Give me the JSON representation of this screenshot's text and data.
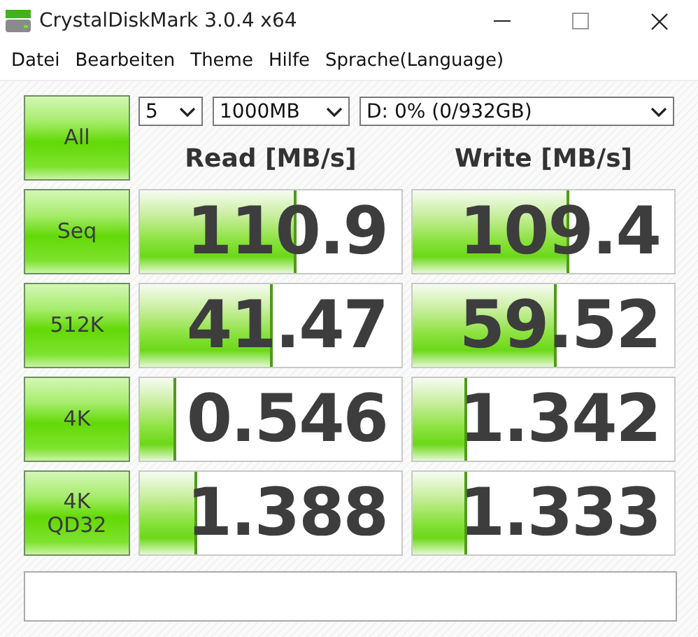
{
  "window": {
    "title": "CrystalDiskMark 3.0.4 x64"
  },
  "menu": [
    "Datei",
    "Bearbeiten",
    "Theme",
    "Hilfe",
    "Sprache(Language)"
  ],
  "all_button": "All",
  "selects": [
    {
      "value": "5"
    },
    {
      "value": "1000MB"
    },
    {
      "value": "D: 0% (0/932GB)"
    }
  ],
  "columns": [
    "Read [MB/s]",
    "Write [MB/s]"
  ],
  "rows": [
    {
      "test": "Seq",
      "read": {
        "value": "110.9",
        "level": 0.6
      },
      "write": {
        "value": "109.4",
        "level": 0.6
      }
    },
    {
      "test": "512K",
      "read": {
        "value": "41.47",
        "level": 0.51
      },
      "write": {
        "value": "59.52",
        "level": 0.55
      }
    },
    {
      "test": "4K",
      "read": {
        "value": "0.546",
        "level": 0.14
      },
      "write": {
        "value": "1.342",
        "level": 0.21
      }
    },
    {
      "test": "4K\nQD32",
      "read": {
        "value": "1.388",
        "level": 0.22
      },
      "write": {
        "value": "1.333",
        "level": 0.21
      }
    }
  ]
}
